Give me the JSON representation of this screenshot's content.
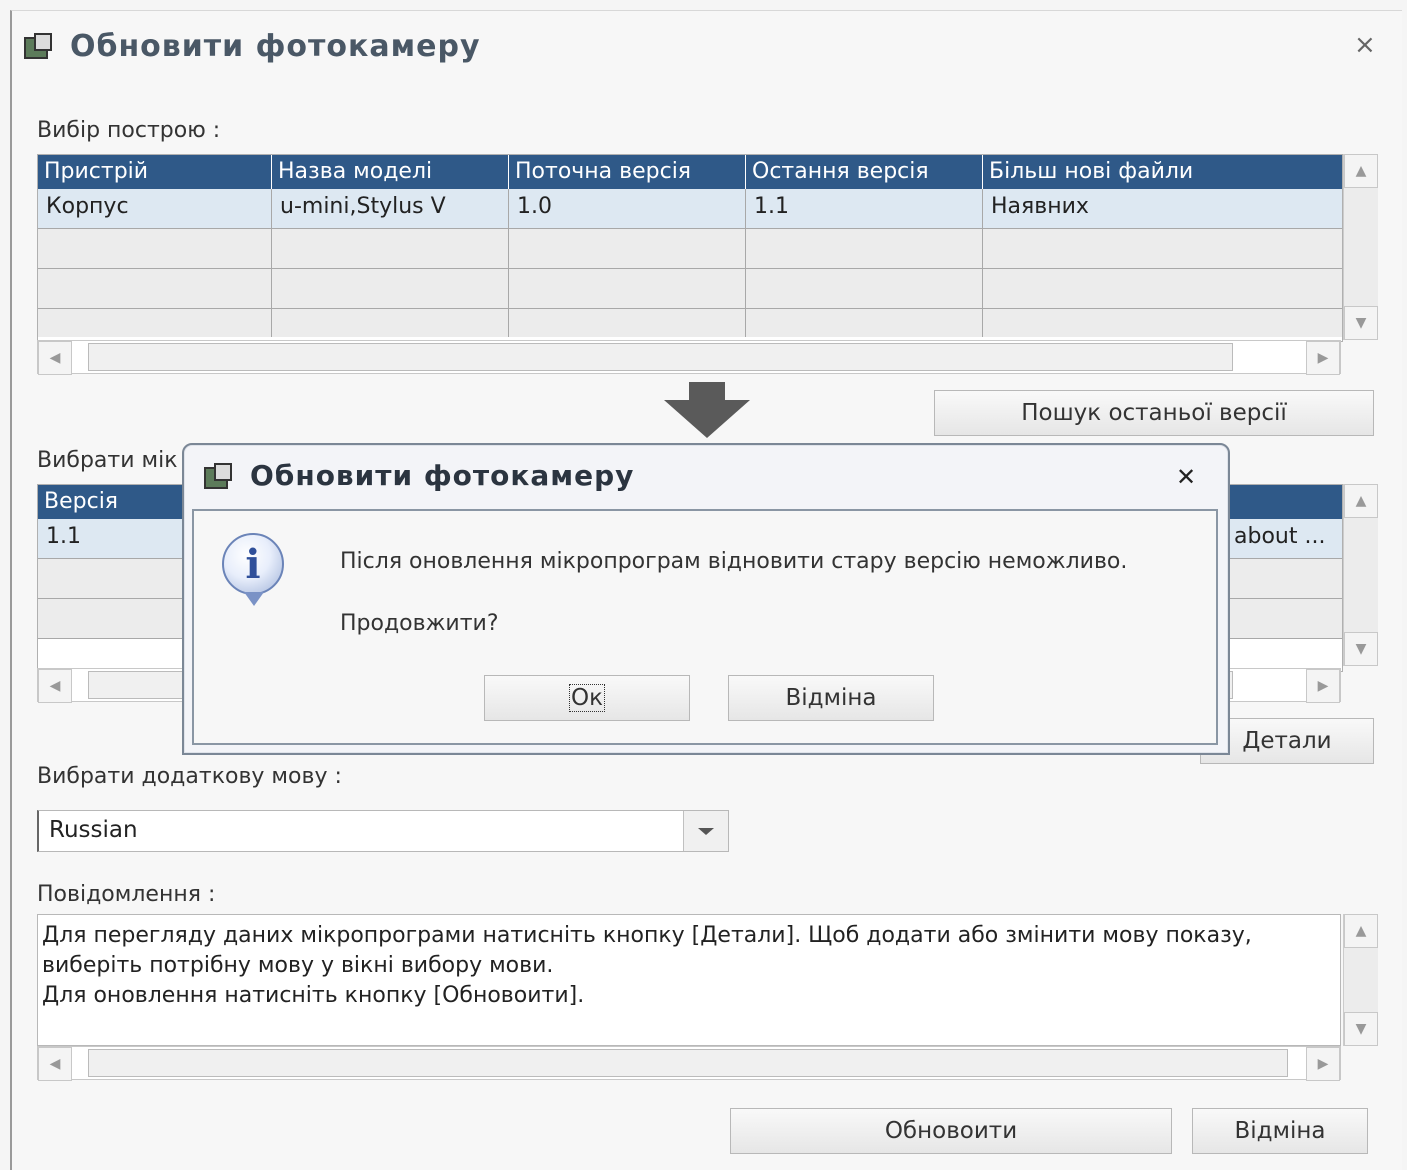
{
  "main_window": {
    "title": "Обновити фотокамеру",
    "close_glyph": "×"
  },
  "device_section": {
    "label": "Вибір построю :",
    "columns": [
      "Пристрій",
      "Назва моделі",
      "Поточна версія",
      "Остання версія",
      "Більш нові файли"
    ],
    "rows": [
      [
        "Корпус",
        "u-mini,Stylus V",
        "1.0",
        "1.1",
        "Наявних"
      ],
      [
        "",
        "",
        "",
        "",
        ""
      ],
      [
        "",
        "",
        "",
        "",
        ""
      ],
      [
        "",
        "",
        "",
        "",
        ""
      ]
    ],
    "search_button": "Пошук останьої версії"
  },
  "firmware_section": {
    "label": "Вибрати мік",
    "column": "Версія",
    "row_value": "1.1",
    "row_suffix": "about ...",
    "details_button": "Детали"
  },
  "language_section": {
    "label": "Вибрати додаткову мову :",
    "selected": "Russian"
  },
  "message_section": {
    "label": "Повідомлення :",
    "lines": [
      "Для перегляду даних мікропрограми натисніть кнопку [Детали]. Щоб додати або змінити мову показу,",
      "виберіть потрібну мову у вікні вибору мови.",
      "Для оновлення натисніть кнопку [Обновоити]."
    ]
  },
  "footer": {
    "update_button": "Обновоити",
    "cancel_button": "Відміна"
  },
  "dialog": {
    "title": "Обновити фотокамеру",
    "close_glyph": "✕",
    "message": "Після оновлення мікропрограм відновити стару версію неможливо.",
    "question": "Продовжити?",
    "ok_button": "Ок",
    "cancel_button": "Відміна",
    "icon_glyph": "i"
  },
  "colors": {
    "header_blue": "#2f5988",
    "selected_row": "#dde8f2",
    "title_gray": "#4a5866",
    "arrow_gray": "#5a5a5a"
  }
}
